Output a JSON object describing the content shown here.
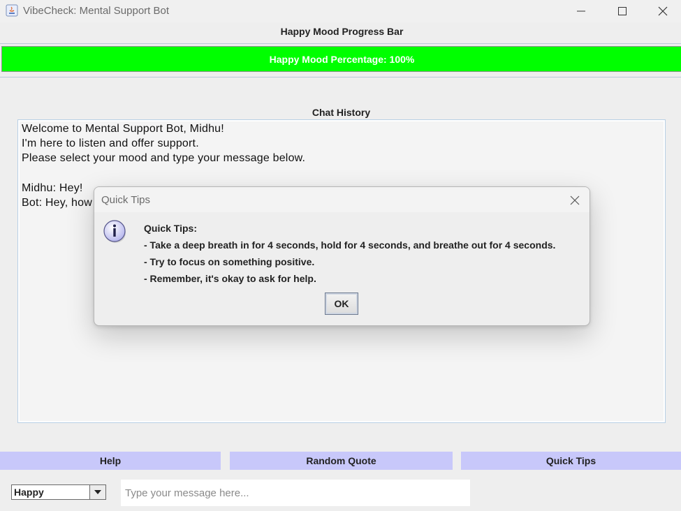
{
  "window": {
    "title": "VibeCheck: Mental Support Bot"
  },
  "progress": {
    "label": "Happy Mood Progress Bar",
    "text": "Happy Mood Percentage: 100%",
    "value": 1.0,
    "fill_color": "#00ff00"
  },
  "chat": {
    "label": "Chat History",
    "lines": [
      "Welcome to Mental Support Bot, Midhu!",
      "I'm here to listen and offer support.",
      "Please select your mood and type your message below.",
      "",
      "Midhu: Hey!",
      "Bot: Hey, how"
    ]
  },
  "buttons": {
    "help": "Help",
    "random_quote": "Random Quote",
    "quick_tips": "Quick Tips",
    "color": "#c8c8fa"
  },
  "mood_select": {
    "value": "Happy"
  },
  "message_input": {
    "placeholder": "Type your message here..."
  },
  "dialog": {
    "title": "Quick Tips",
    "heading": "Quick Tips:",
    "tips": [
      "- Take a deep breath in for 4 seconds, hold for 4 seconds, and breathe out for 4 seconds.",
      "- Try to focus on something positive.",
      "- Remember, it's okay to ask for help."
    ],
    "ok_label": "OK",
    "icon": "info-icon"
  },
  "icons": {
    "app": "java-app-icon",
    "minimize": "minimize-icon",
    "maximize": "maximize-icon",
    "close": "close-icon",
    "dropdown": "chevron-down-icon"
  }
}
